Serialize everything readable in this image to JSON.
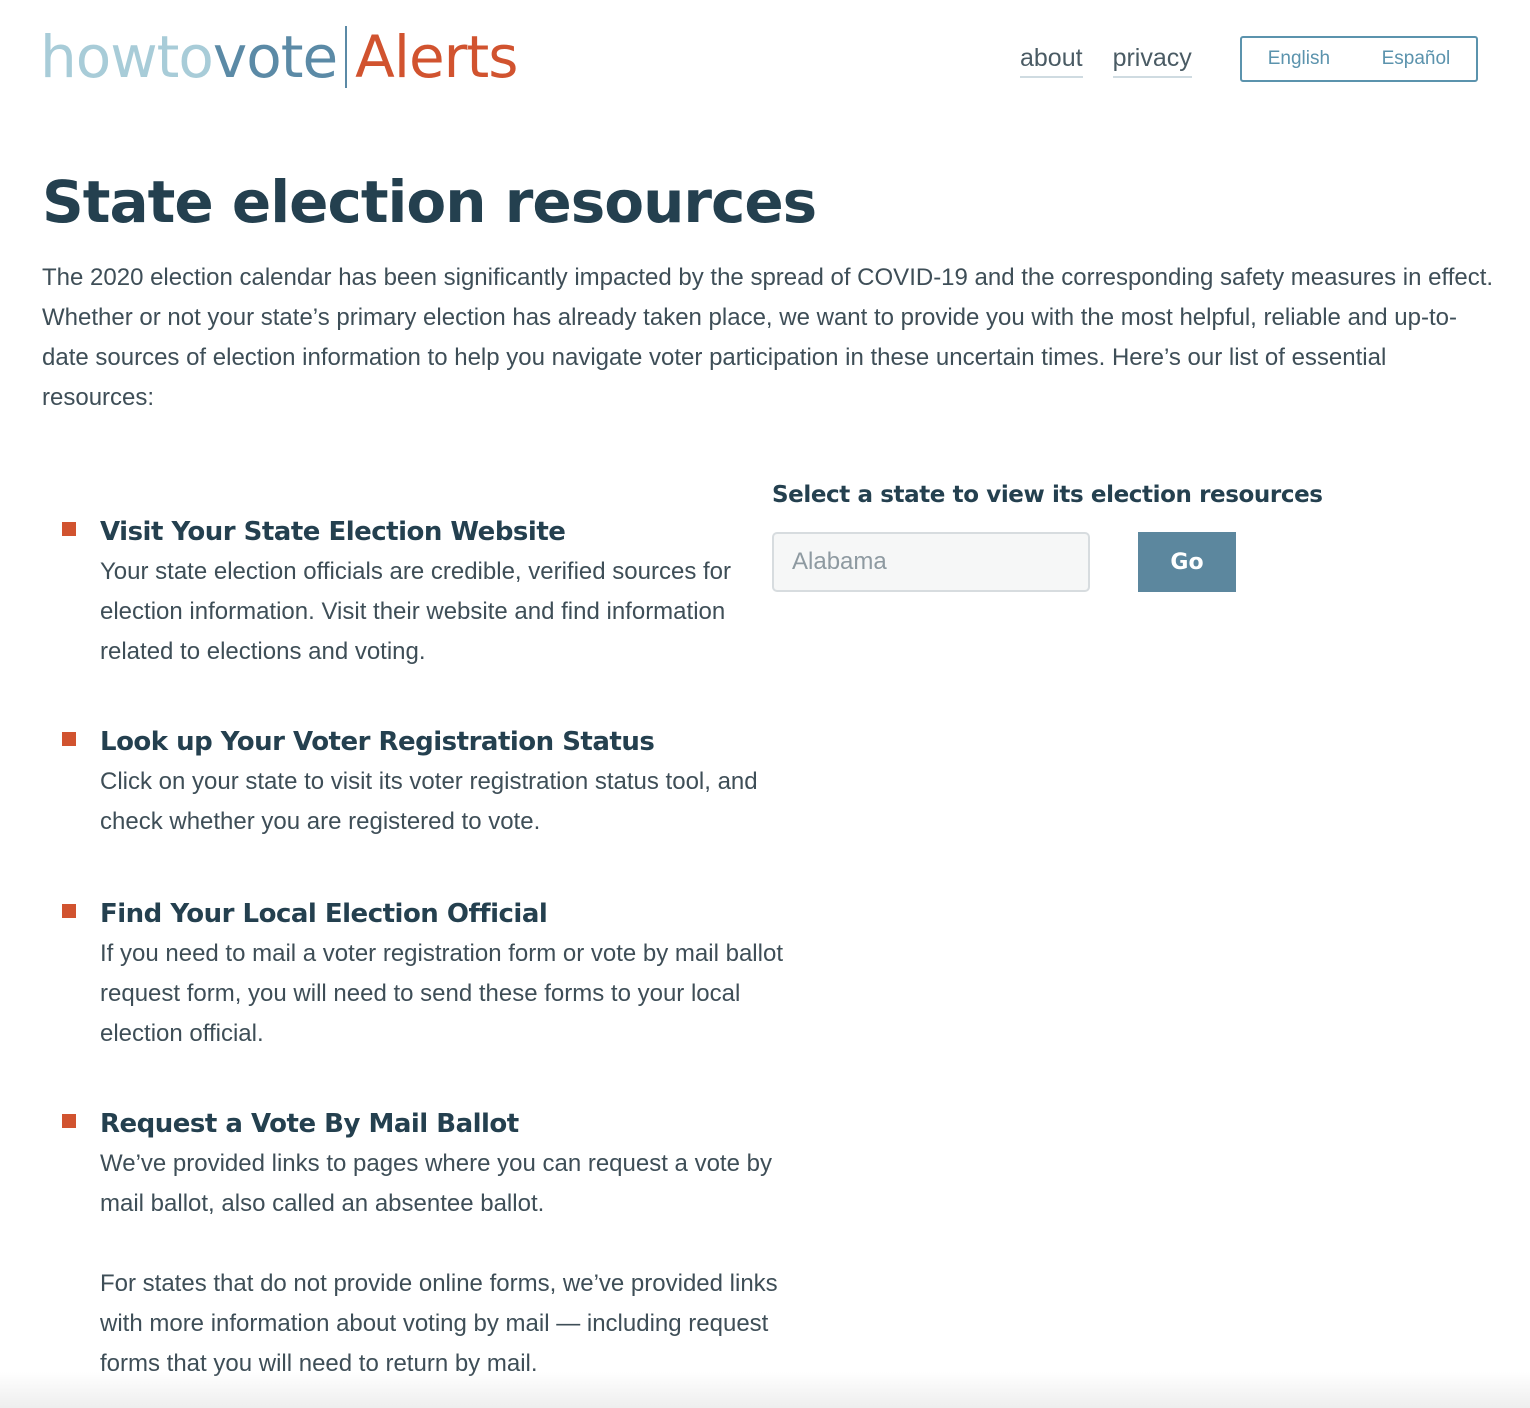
{
  "header": {
    "logo": {
      "part_how": "howto",
      "part_vote": "vote",
      "part_alerts": "Alerts"
    },
    "nav": [
      {
        "label": "about"
      },
      {
        "label": "privacy"
      }
    ],
    "languages": [
      {
        "label": "English"
      },
      {
        "label": "Español"
      }
    ]
  },
  "main": {
    "title": "State election resources",
    "intro": "The 2020 election calendar has been significantly impacted by the spread of COVID-19 and the corresponding safety measures in effect. Whether or not your state’s primary election has already taken place, we want to provide you with the most helpful, reliable and up-to-date sources of election information to help you navigate voter participation in these uncertain times. Here’s our list of essential resources:",
    "resources": [
      {
        "title": "Visit Your State Election Website",
        "paragraphs": [
          "Your state election officials are credible, verified sources for election information. Visit their website and find information related to elections and voting."
        ]
      },
      {
        "title": "Look up Your Voter Registration Status",
        "paragraphs": [
          "Click on your state to visit its voter registration status tool, and check whether you are registered to vote."
        ]
      },
      {
        "title": "Find Your Local Election Official",
        "paragraphs": [
          "If you need to mail a voter registration form or vote by mail ballot request form, you will need to send these forms to your local election official."
        ]
      },
      {
        "title": "Request a Vote By Mail Ballot",
        "paragraphs": [
          "We’ve provided links to pages where you can request a vote by mail ballot, also called an absentee ballot.",
          "For states that do not provide online forms, we’ve provided links with more information about voting by mail — including request forms that you will need to return by mail."
        ]
      }
    ],
    "state_selector": {
      "heading": "Select a state to view its election resources",
      "placeholder": "Alabama",
      "button_label": "Go"
    }
  },
  "colors": {
    "logo_how": "#a8ccd8",
    "logo_vote": "#5b8aa6",
    "logo_alerts": "#d1532f",
    "heading": "#24404f",
    "bullet": "#d1532f",
    "button": "#5c879e"
  }
}
